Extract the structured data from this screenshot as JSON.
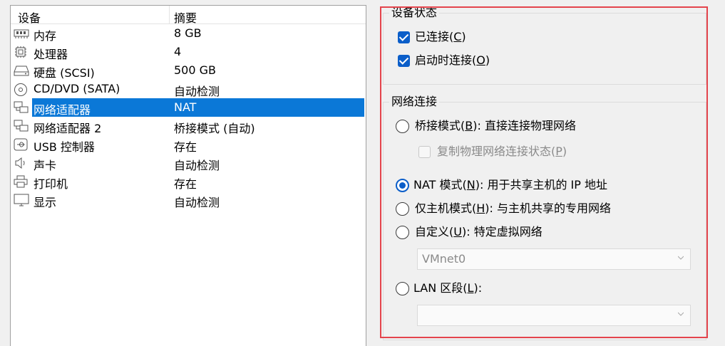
{
  "device_list": {
    "columns": {
      "device": "设备",
      "summary": "摘要"
    },
    "rows": [
      {
        "icon": "memory-icon",
        "label": "内存",
        "summary": "8 GB"
      },
      {
        "icon": "processor-icon",
        "label": "处理器",
        "summary": "4"
      },
      {
        "icon": "hard-disk-icon",
        "label": "硬盘 (SCSI)",
        "summary": "500 GB"
      },
      {
        "icon": "cd-dvd-icon",
        "label": "CD/DVD (SATA)",
        "summary": "自动检测"
      },
      {
        "icon": "network-adapter-icon",
        "label": "网络适配器",
        "summary": "NAT",
        "selected": true
      },
      {
        "icon": "network-adapter-icon",
        "label": "网络适配器 2",
        "summary": "桥接模式 (自动)"
      },
      {
        "icon": "usb-icon",
        "label": "USB 控制器",
        "summary": "存在"
      },
      {
        "icon": "speaker-icon",
        "label": "声卡",
        "summary": "自动检测"
      },
      {
        "icon": "printer-icon",
        "label": "打印机",
        "summary": "存在"
      },
      {
        "icon": "monitor-icon",
        "label": "显示",
        "summary": "自动检测"
      }
    ]
  },
  "device_status": {
    "title": "设备状态",
    "connected": {
      "text": "已连接(",
      "key": "C",
      "end": ")",
      "checked": true
    },
    "connect_at_power_on": {
      "text": "启动时连接(",
      "key": "O",
      "end": ")",
      "checked": true
    }
  },
  "network_connection": {
    "title": "网络连接",
    "bridged": {
      "text": "桥接模式(",
      "key": "B",
      "end": "): 直接连接物理网络",
      "checked": false
    },
    "replicate": {
      "text": "复制物理网络连接状态(",
      "key": "P",
      "end": ")",
      "checked": false,
      "disabled": true
    },
    "nat": {
      "text": "NAT 模式(",
      "key": "N",
      "end": "): 用于共享主机的 IP 地址",
      "checked": true
    },
    "host_only": {
      "text": "仅主机模式(",
      "key": "H",
      "end": "): 与主机共享的专用网络",
      "checked": false
    },
    "custom": {
      "text": "自定义(",
      "key": "U",
      "end": "): 特定虚拟网络",
      "checked": false
    },
    "custom_select": {
      "value": "VMnet0"
    },
    "lan_segment": {
      "text": "LAN 区段(",
      "key": "L",
      "end": "):",
      "checked": false
    },
    "lan_select": {
      "value": ""
    }
  },
  "colors": {
    "selection": "#0b78d7",
    "accent": "#0b5ec9",
    "highlight_border": "#e4444c"
  }
}
